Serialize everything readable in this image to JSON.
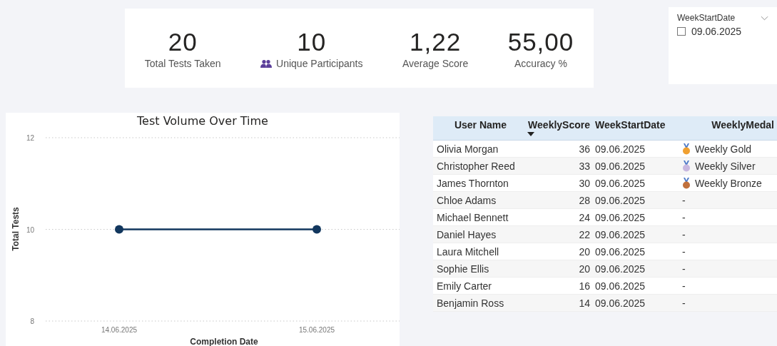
{
  "kpis": [
    {
      "value": "20",
      "label": "Total Tests Taken",
      "icon": false
    },
    {
      "value": "10",
      "label": "Unique Participants",
      "icon": true
    },
    {
      "value": "1,22",
      "label": "Average Score",
      "icon": false
    },
    {
      "value": "55,00",
      "label": "Accuracy %",
      "icon": false
    }
  ],
  "slicer": {
    "title": "WeekStartDate",
    "options": [
      {
        "label": "09.06.2025",
        "checked": false
      }
    ]
  },
  "chart": {
    "chart_data": {
      "type": "line",
      "title": "Test Volume Over Time",
      "xlabel": "Completion Date",
      "ylabel": "Total Tests",
      "categories": [
        "14.06.2025",
        "15.06.2025"
      ],
      "series": [
        {
          "color": "#12375e",
          "marker": "circle",
          "values": [
            10,
            10
          ]
        }
      ],
      "ylim": [
        8,
        12
      ],
      "yticks": [
        8,
        10,
        12
      ]
    }
  },
  "table": {
    "columns": [
      {
        "label": "User Name",
        "sorted": false
      },
      {
        "label": "WeeklyScore",
        "sorted": true
      },
      {
        "label": "WeekStartDate",
        "sorted": false
      },
      {
        "label": "WeeklyMedal",
        "sorted": false
      }
    ],
    "rows": [
      {
        "name": "Olivia Morgan",
        "score": "36",
        "date": "09.06.2025",
        "medal": "Weekly Gold",
        "color": "#f0a030"
      },
      {
        "name": "Christopher Reed",
        "score": "33",
        "date": "09.06.2025",
        "medal": "Weekly Silver",
        "color": "#c8b8e0"
      },
      {
        "name": "James Thornton",
        "score": "30",
        "date": "09.06.2025",
        "medal": "Weekly Bronze",
        "color": "#c0703c"
      },
      {
        "name": "Chloe Adams",
        "score": "28",
        "date": "09.06.2025",
        "medal": "-"
      },
      {
        "name": "Michael Bennett",
        "score": "24",
        "date": "09.06.2025",
        "medal": "-"
      },
      {
        "name": "Daniel Hayes",
        "score": "22",
        "date": "09.06.2025",
        "medal": "-"
      },
      {
        "name": "Laura Mitchell",
        "score": "20",
        "date": "09.06.2025",
        "medal": "-"
      },
      {
        "name": "Sophie Ellis",
        "score": "20",
        "date": "09.06.2025",
        "medal": "-"
      },
      {
        "name": "Emily Carter",
        "score": "16",
        "date": "09.06.2025",
        "medal": "-"
      },
      {
        "name": "Benjamin Ross",
        "score": "14",
        "date": "09.06.2025",
        "medal": "-"
      }
    ]
  }
}
